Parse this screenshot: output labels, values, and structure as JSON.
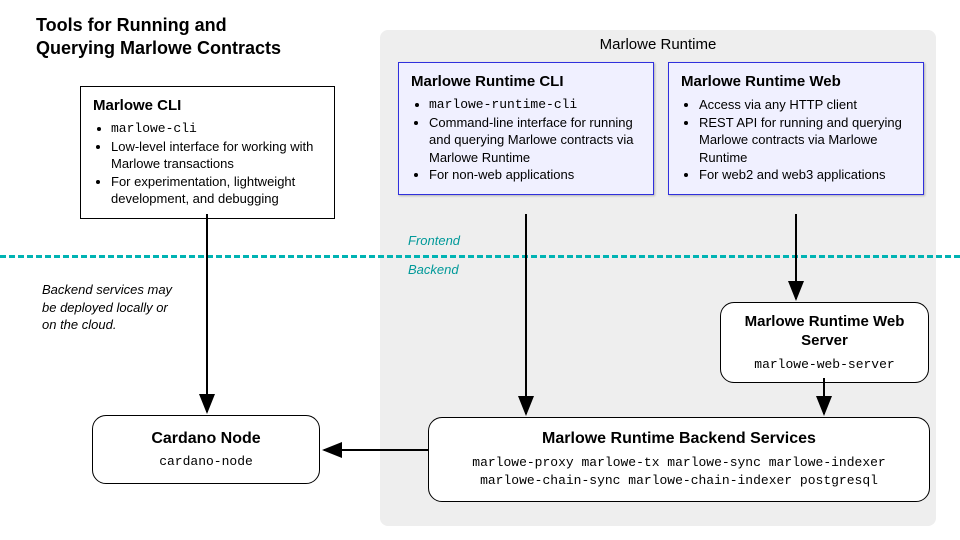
{
  "title_line1": "Tools for Running and",
  "title_line2": "Querying Marlowe Contracts",
  "runtime_group_label": "Marlowe Runtime",
  "front_label": "Frontend",
  "back_label": "Backend",
  "note_line1": "Backend services may",
  "note_line2": "be deployed locally or",
  "note_line3": "on the cloud.",
  "cli": {
    "title": "Marlowe CLI",
    "code": "marlowe-cli",
    "b1": "Low-level interface for working with Marlowe transactions",
    "b2": "For experimentation, lightweight development, and debugging"
  },
  "rt_cli": {
    "title": "Marlowe Runtime CLI",
    "code": "marlowe-runtime-cli",
    "b1": "Command-line interface for running and querying Marlowe contracts via Marlowe Runtime",
    "b2": "For non-web applications"
  },
  "rt_web": {
    "title": "Marlowe Runtime Web",
    "b0": "Access via any HTTP client",
    "b1": "REST API for running and querying Marlowe contracts via Marlowe Runtime",
    "b2": "For web2 and web3 applications"
  },
  "web_server": {
    "title_l1": "Marlowe Runtime Web",
    "title_l2": "Server",
    "code": "marlowe-web-server"
  },
  "backend": {
    "title": "Marlowe Runtime Backend Services",
    "code_l1": "marlowe-proxy marlowe-tx marlowe-sync marlowe-indexer",
    "code_l2": "marlowe-chain-sync marlowe-chain-indexer postgresql"
  },
  "cardano": {
    "title": "Cardano Node",
    "code": "cardano-node"
  }
}
